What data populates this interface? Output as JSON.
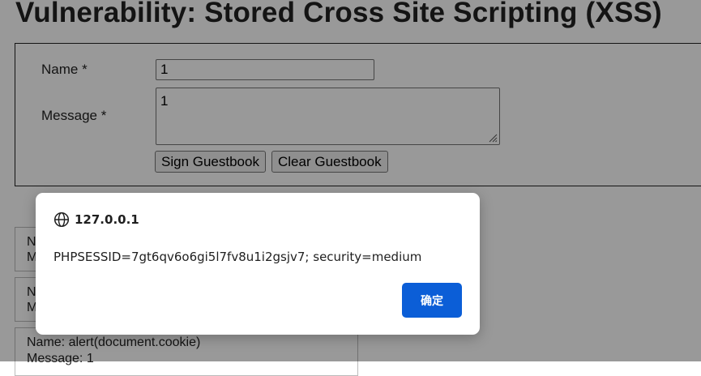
{
  "page": {
    "title": "Vulnerability: Stored Cross Site Scripting (XSS)"
  },
  "form": {
    "name_label": "Name *",
    "name_value": "1",
    "message_label": "Message *",
    "message_value": "1",
    "sign_button": "Sign Guestbook",
    "clear_button": "Clear Guestbook"
  },
  "entries": [
    {
      "name_line": "N",
      "message_line": "M"
    },
    {
      "name_line": "N",
      "message_line": "M"
    },
    {
      "name_line": "Name: alert(document.cookie)",
      "message_line": "Message: 1"
    }
  ],
  "alert": {
    "origin": "127.0.0.1",
    "origin_icon": "globe-icon",
    "message": "PHPSESSID=7gt6qv6o6gi5l7fv8u1i2gsjv7; security=medium",
    "ok_label": "确定",
    "ok_color": "#0b5ed7"
  },
  "colors": {
    "overlay": "rgba(0,0,0,0.40)",
    "dialog_bg": "#ffffff"
  }
}
